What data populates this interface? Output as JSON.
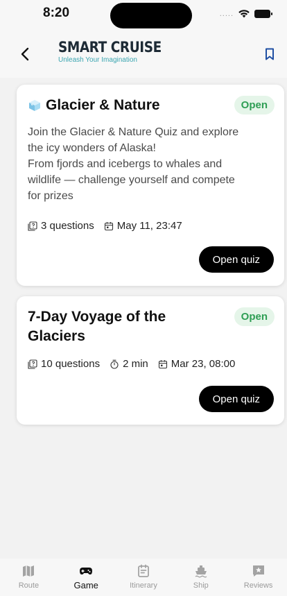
{
  "status_bar": {
    "time": "8:20",
    "signal": "....."
  },
  "header": {
    "logo_title": "SMART CRUISE",
    "logo_subtitle": "Unleash Your Imagination",
    "back_icon": "chevron-left-icon",
    "bookmark_icon": "bookmark-icon"
  },
  "quizzes": [
    {
      "title": "Glacier & Nature",
      "title_icon": "ice-cube-icon",
      "status": "Open",
      "description": [
        "Join the Glacier & Nature Quiz and explore",
        "the icy wonders of Alaska!",
        "From fjords and icebergs to whales and",
        "wildlife — challenge yourself and compete",
        "for prizes"
      ],
      "questions": "3 questions",
      "date": "May 11, 23:47",
      "button": "Open quiz"
    },
    {
      "title": "7-Day Voyage of the Glaciers",
      "status": "Open",
      "questions": "10 questions",
      "duration": "2 min",
      "date": "Mar 23, 08:00",
      "button": "Open quiz"
    }
  ],
  "tab_bar": {
    "active": "Game",
    "tabs": [
      {
        "label": "Route",
        "icon": "map-icon"
      },
      {
        "label": "Game",
        "icon": "gamepad-icon"
      },
      {
        "label": "Itinerary",
        "icon": "itinerary-icon"
      },
      {
        "label": "Ship",
        "icon": "ship-icon"
      },
      {
        "label": "Reviews",
        "icon": "review-icon"
      }
    ]
  },
  "colors": {
    "open_badge_bg": "#e5f5e9",
    "open_badge_text": "#2e9e54",
    "accent_teal": "#3aa5b0",
    "button_bg": "#000000"
  }
}
